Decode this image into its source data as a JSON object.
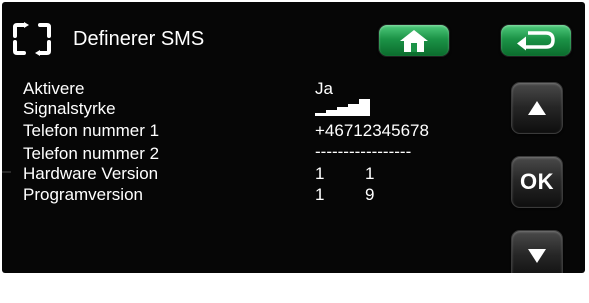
{
  "header": {
    "title": "Definerer SMS",
    "menu_icon": "rotate-frame-icon",
    "home_icon": "home-icon",
    "back_icon": "back-arrow-icon",
    "button_color": "#1c9347"
  },
  "settings": [
    {
      "label": "Aktivere",
      "value": "Ja"
    },
    {
      "label": "Signalstyrke",
      "value_type": "signal-bars",
      "bars_filled": 5,
      "bars_total": 5
    },
    {
      "label": "Telefon nummer 1",
      "value": "+46712345678"
    },
    {
      "label": "Telefon nummer 2",
      "value": "-----------------"
    },
    {
      "label": "Hardware Version",
      "major": "1",
      "minor": "1"
    },
    {
      "label": "Programversion",
      "major": "1",
      "minor": "9"
    }
  ],
  "side_buttons": {
    "up_icon": "triangle-up-icon",
    "ok_label": "OK",
    "down_icon": "triangle-down-icon"
  },
  "colors": {
    "background": "#060606",
    "text": "#ffffff",
    "green_button": "#1c9347",
    "dark_button": "#262626"
  }
}
